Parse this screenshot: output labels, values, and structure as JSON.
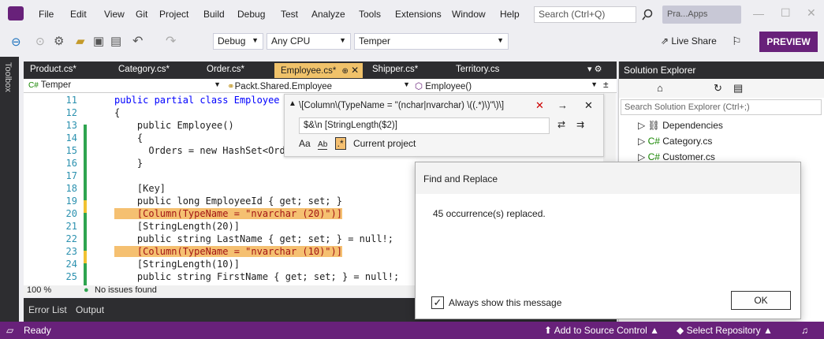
{
  "menubar": {
    "items": [
      "File",
      "Edit",
      "View",
      "Git",
      "Project",
      "Build",
      "Debug",
      "Test",
      "Analyze",
      "Tools",
      "Extensions",
      "Window",
      "Help"
    ],
    "search_placeholder": "Search (Ctrl+Q)",
    "app_badge": "Pra...Apps"
  },
  "toolbar": {
    "config": "Debug",
    "platform": "Any CPU",
    "startup": "Temper",
    "live_share": "Live Share",
    "preview": "PREVIEW"
  },
  "toolbox": {
    "label": "Toolbox"
  },
  "tabs": [
    "Product.cs*",
    "Category.cs*",
    "Order.cs*",
    "Employee.cs*",
    "Shipper.cs*",
    "Territory.cs"
  ],
  "navbar": {
    "project": "Temper",
    "class": "Packt.Shared.Employee",
    "member": "Employee()"
  },
  "editor": {
    "lines": [
      {
        "n": "11",
        "t": "public partial class Employee"
      },
      {
        "n": "12",
        "t": "{"
      },
      {
        "n": "13",
        "t": "    public Employee()"
      },
      {
        "n": "14",
        "t": "    {"
      },
      {
        "n": "15",
        "t": "      Orders = new HashSet<Order"
      },
      {
        "n": "16",
        "t": "    }"
      },
      {
        "n": "17",
        "t": ""
      },
      {
        "n": "18",
        "t": "    [Key]"
      },
      {
        "n": "19",
        "t": "    public long EmployeeId { get; set; }"
      },
      {
        "n": "20",
        "t": "    [Column(TypeName = \"nvarchar (20)\")]"
      },
      {
        "n": "21",
        "t": "    [StringLength(20)]"
      },
      {
        "n": "22",
        "t": "    public string LastName { get; set; } = null!;"
      },
      {
        "n": "23",
        "t": "    [Column(TypeName = \"nvarchar (10)\")]"
      },
      {
        "n": "24",
        "t": "    [StringLength(10)]"
      },
      {
        "n": "25",
        "t": "    public string FirstName { get; set; } = null!;"
      }
    ]
  },
  "find": {
    "find_text": "\\[Column\\(TypeName = \"(nchar|nvarchar) \\((.*)\\)\"\\)\\]",
    "replace_text": "$&\\n   [StringLength($2)]",
    "scope": "Current project"
  },
  "editor_status": {
    "zoom": "100 %",
    "issues": "No issues found"
  },
  "bottom_tabs": [
    "Error List",
    "Output"
  ],
  "solution": {
    "title": "Solution Explorer",
    "search_placeholder": "Search Solution Explorer (Ctrl+;)",
    "items": [
      "Dependencies",
      "Category.cs",
      "Customer.cs"
    ]
  },
  "dialog": {
    "title": "Find and Replace",
    "message": "45 occurrence(s) replaced.",
    "checkbox_label": "Always show this message",
    "ok": "OK"
  },
  "statusbar": {
    "ready": "Ready",
    "source_control": "Add to Source Control",
    "repo": "Select Repository"
  }
}
